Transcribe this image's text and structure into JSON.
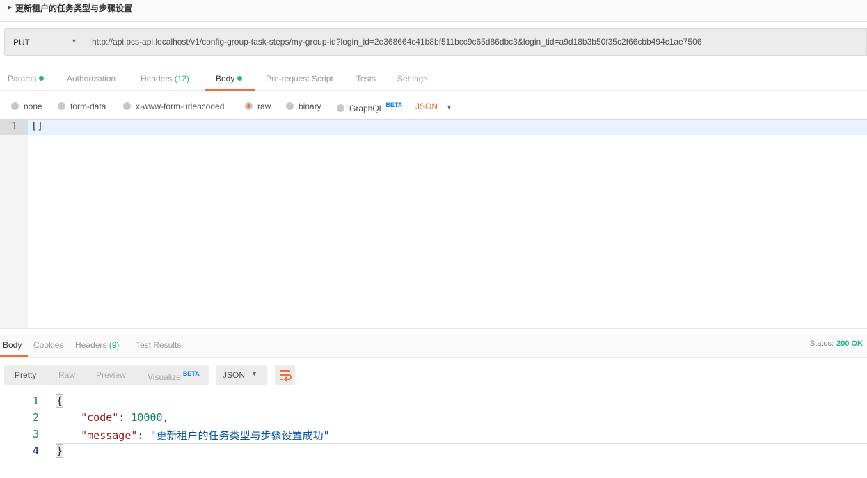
{
  "request": {
    "title": "更新租户的任务类型与步骤设置",
    "method": "PUT",
    "url": "http://api.pcs-api.localhost/v1/config-group-task-steps/my-group-id?login_id=2e368664c41b8bf511bcc9c65d86dbc3&login_tid=a9d18b3b50f35c2f66cbb494c1ae7506"
  },
  "tabs": {
    "params": "Params",
    "authorization": "Authorization",
    "headers": "Headers",
    "headers_count": "(12)",
    "body": "Body",
    "prerequest": "Pre-request Script",
    "tests": "Tests",
    "settings": "Settings"
  },
  "body_types": {
    "none": "none",
    "form_data": "form-data",
    "urlencoded": "x-www-form-urlencoded",
    "raw": "raw",
    "binary": "binary",
    "graphql": "GraphQL",
    "beta": "BETA",
    "format": "JSON"
  },
  "editor": {
    "line": "1",
    "code": "[]"
  },
  "response": {
    "tabs": {
      "body": "Body",
      "cookies": "Cookies",
      "headers": "Headers",
      "headers_count": "(9)",
      "tests": "Test Results"
    },
    "status_label": "Status:",
    "status_value": "200 OK",
    "views": {
      "pretty": "Pretty",
      "raw": "Raw",
      "preview": "Preview",
      "visualize": "Visualize",
      "beta": "BETA"
    },
    "format": "JSON",
    "lines": [
      "1",
      "2",
      "3",
      "4"
    ],
    "code_key": "\"code\"",
    "code_value": "10000",
    "message_key": "\"message\"",
    "message_value": "\"更新租户的任务类型与步骤设置成功\""
  }
}
